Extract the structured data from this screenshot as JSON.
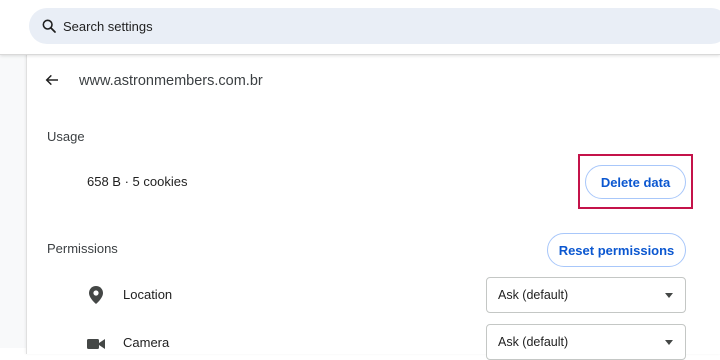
{
  "search": {
    "placeholder": "Search settings",
    "icon": "search-icon"
  },
  "site": {
    "title": "www.astronmembers.com.br",
    "back_icon": "arrow-back-icon"
  },
  "usage": {
    "heading": "Usage",
    "summary": "658 B · 5 cookies",
    "delete_label": "Delete data"
  },
  "permissions": {
    "heading": "Permissions",
    "reset_label": "Reset permissions",
    "items": [
      {
        "icon": "location-pin-icon",
        "label": "Location",
        "value": "Ask (default)"
      },
      {
        "icon": "camera-icon",
        "label": "Camera",
        "value": "Ask (default)"
      }
    ]
  },
  "colors": {
    "accent": "#0b57d0",
    "highlight": "#c4134a",
    "search_bg": "#e9eef6"
  }
}
